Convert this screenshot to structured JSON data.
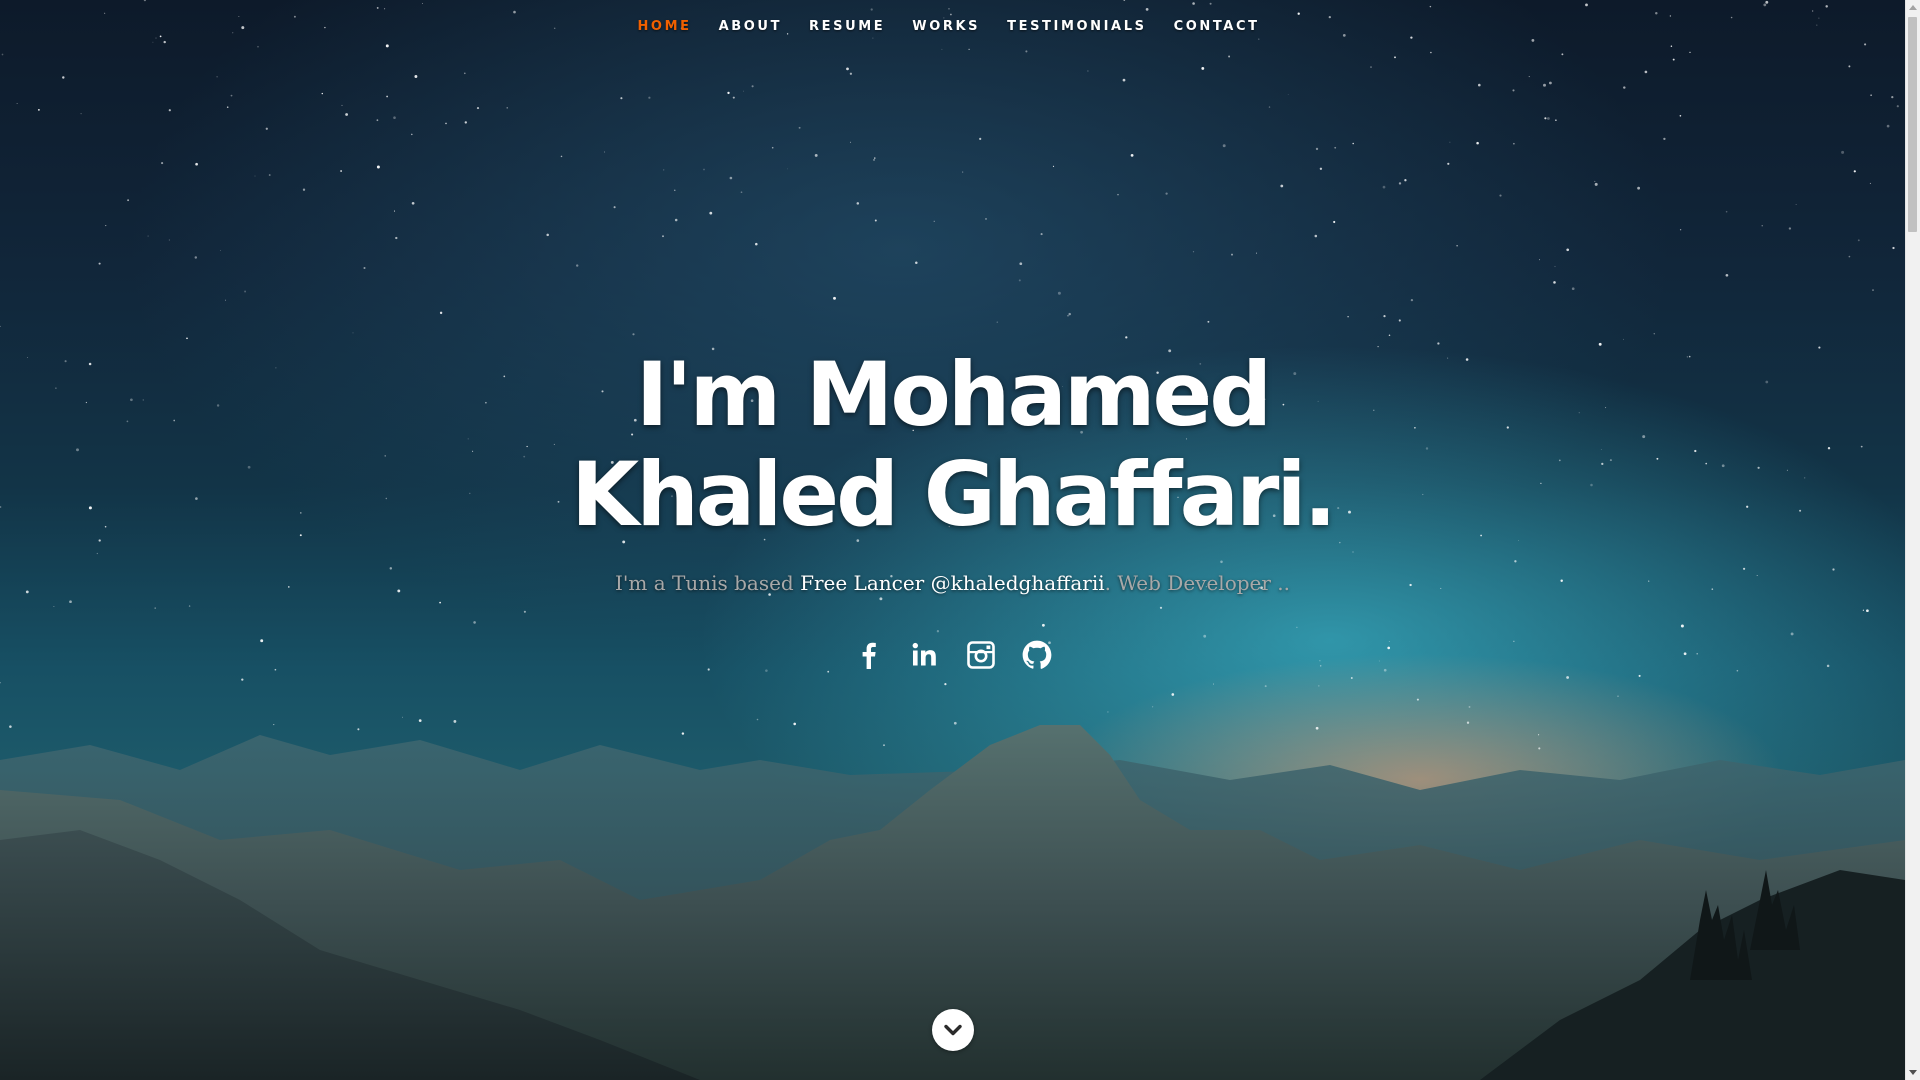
{
  "nav": {
    "items": [
      {
        "label": "Home",
        "active": true
      },
      {
        "label": "About",
        "active": false
      },
      {
        "label": "Resume",
        "active": false
      },
      {
        "label": "Works",
        "active": false
      },
      {
        "label": "Testimonials",
        "active": false
      },
      {
        "label": "Contact",
        "active": false
      }
    ],
    "active_color": "#F06000"
  },
  "banner": {
    "headline": "I'm Mohamed Khaled Ghaffari.",
    "subtitle_before": "I'm a Tunis based ",
    "subtitle_highlight": "Free Lancer @khaledghaffarii",
    "subtitle_after": ". Web Developer .."
  },
  "social": [
    {
      "icon": "facebook-icon"
    },
    {
      "icon": "linkedin-icon"
    },
    {
      "icon": "instagram-icon"
    },
    {
      "icon": "github-icon"
    }
  ],
  "scroll": {
    "icon": "chevron-down-icon"
  }
}
